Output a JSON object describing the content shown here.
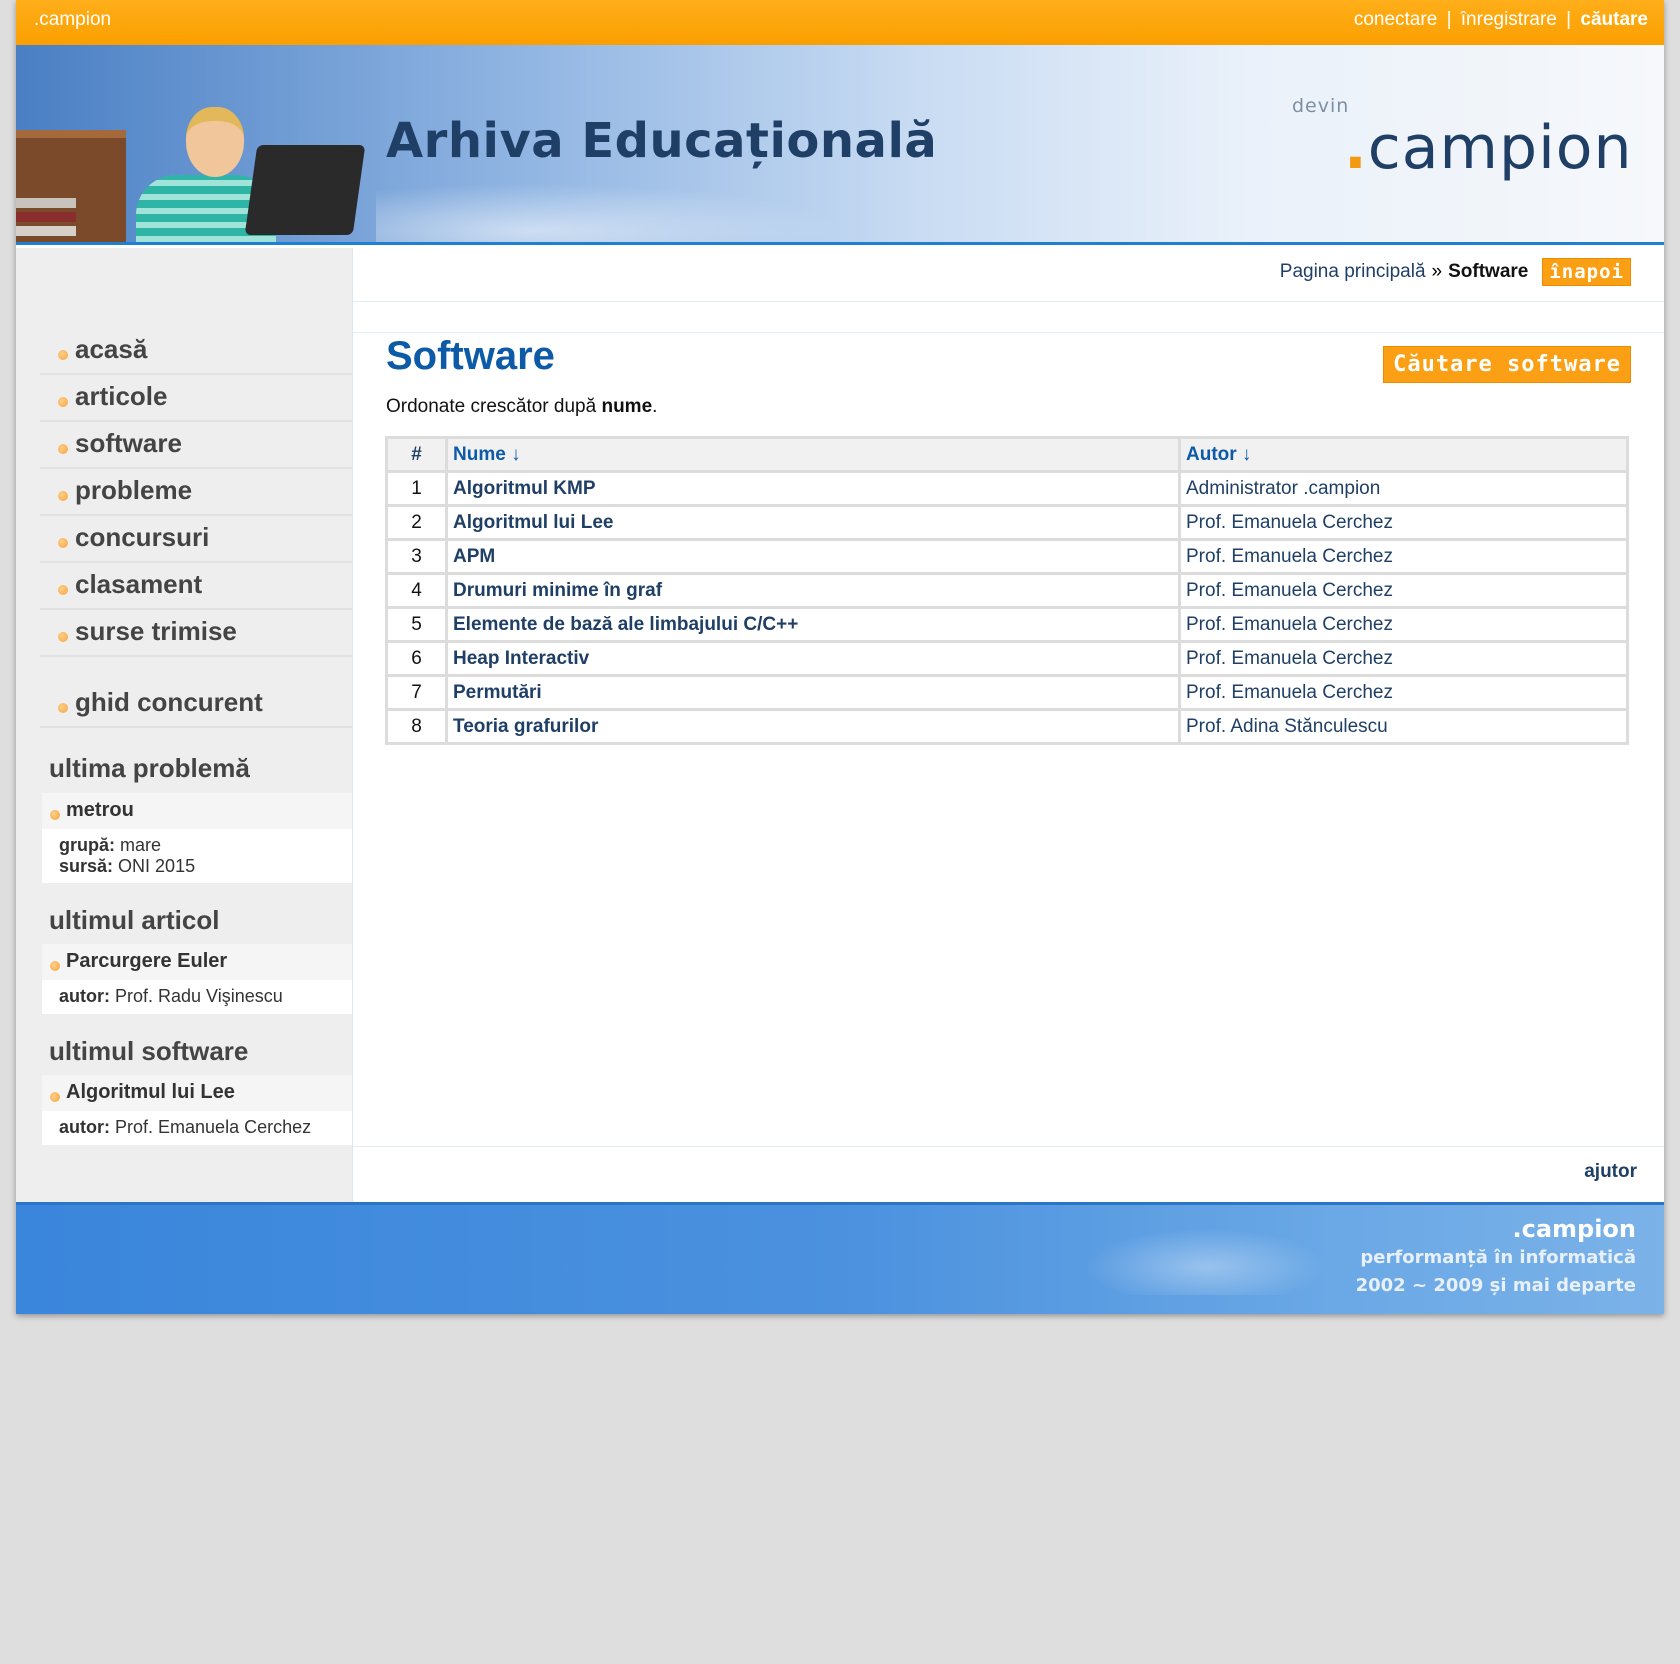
{
  "topbar": {
    "brand": ".campion",
    "links": [
      "conectare",
      "înregistrare",
      "căutare"
    ],
    "separator": "|"
  },
  "banner": {
    "title": "Arhiva Educațională",
    "devin": "devin",
    "logo": "campion",
    "logo_dot": "."
  },
  "breadcrumb": {
    "home": "Pagina principală",
    "arrow": "»",
    "current": "Software",
    "back": "înapoi"
  },
  "main": {
    "title": "Software",
    "search_button": "Căutare software",
    "sort_prefix": "Ordonate crescător după",
    "sort_field": "nume",
    "sort_suffix": ".",
    "columns": [
      "#",
      "Nume ↓",
      "Autor ↓"
    ],
    "rows": [
      {
        "num": "1",
        "name": "Algoritmul KMP",
        "author": "Administrator .campion"
      },
      {
        "num": "2",
        "name": "Algoritmul lui Lee",
        "author": "Prof. Emanuela Cerchez"
      },
      {
        "num": "3",
        "name": "APM",
        "author": "Prof. Emanuela Cerchez"
      },
      {
        "num": "4",
        "name": "Drumuri minime în graf",
        "author": "Prof. Emanuela Cerchez"
      },
      {
        "num": "5",
        "name": "Elemente de bază ale limbajului C/C++",
        "author": "Prof. Emanuela Cerchez"
      },
      {
        "num": "6",
        "name": "Heap Interactiv",
        "author": "Prof. Emanuela Cerchez"
      },
      {
        "num": "7",
        "name": "Permutări",
        "author": "Prof. Emanuela Cerchez"
      },
      {
        "num": "8",
        "name": "Teoria grafurilor",
        "author": "Prof. Adina Stănculescu"
      }
    ],
    "help": "ajutor"
  },
  "sidebar": {
    "menu": [
      "acasă",
      "articole",
      "software",
      "probleme",
      "concursuri",
      "clasament",
      "surse trimise"
    ],
    "guide": "ghid concurent",
    "last_problem": {
      "title": "ultima problemă",
      "name": "metrou",
      "group_label": "grupă:",
      "group_value": "mare",
      "source_label": "sursă:",
      "source_value": "ONI 2015"
    },
    "last_article": {
      "title": "ultimul articol",
      "name": "Parcurgere Euler",
      "author_label": "autor:",
      "author_value": "Prof. Radu Vişinescu"
    },
    "last_software": {
      "title": "ultimul software",
      "name": "Algoritmul lui Lee",
      "author_label": "autor:",
      "author_value": "Prof. Emanuela Cerchez"
    }
  },
  "footer": {
    "brand": ".campion",
    "tagline": "performanță în informatică",
    "years": "2002 ~ 2009 și mai departe"
  },
  "colors": {
    "accent_orange": "#fb9f00",
    "title_blue": "#0d5aa7",
    "link_navy": "#1f3f66"
  }
}
